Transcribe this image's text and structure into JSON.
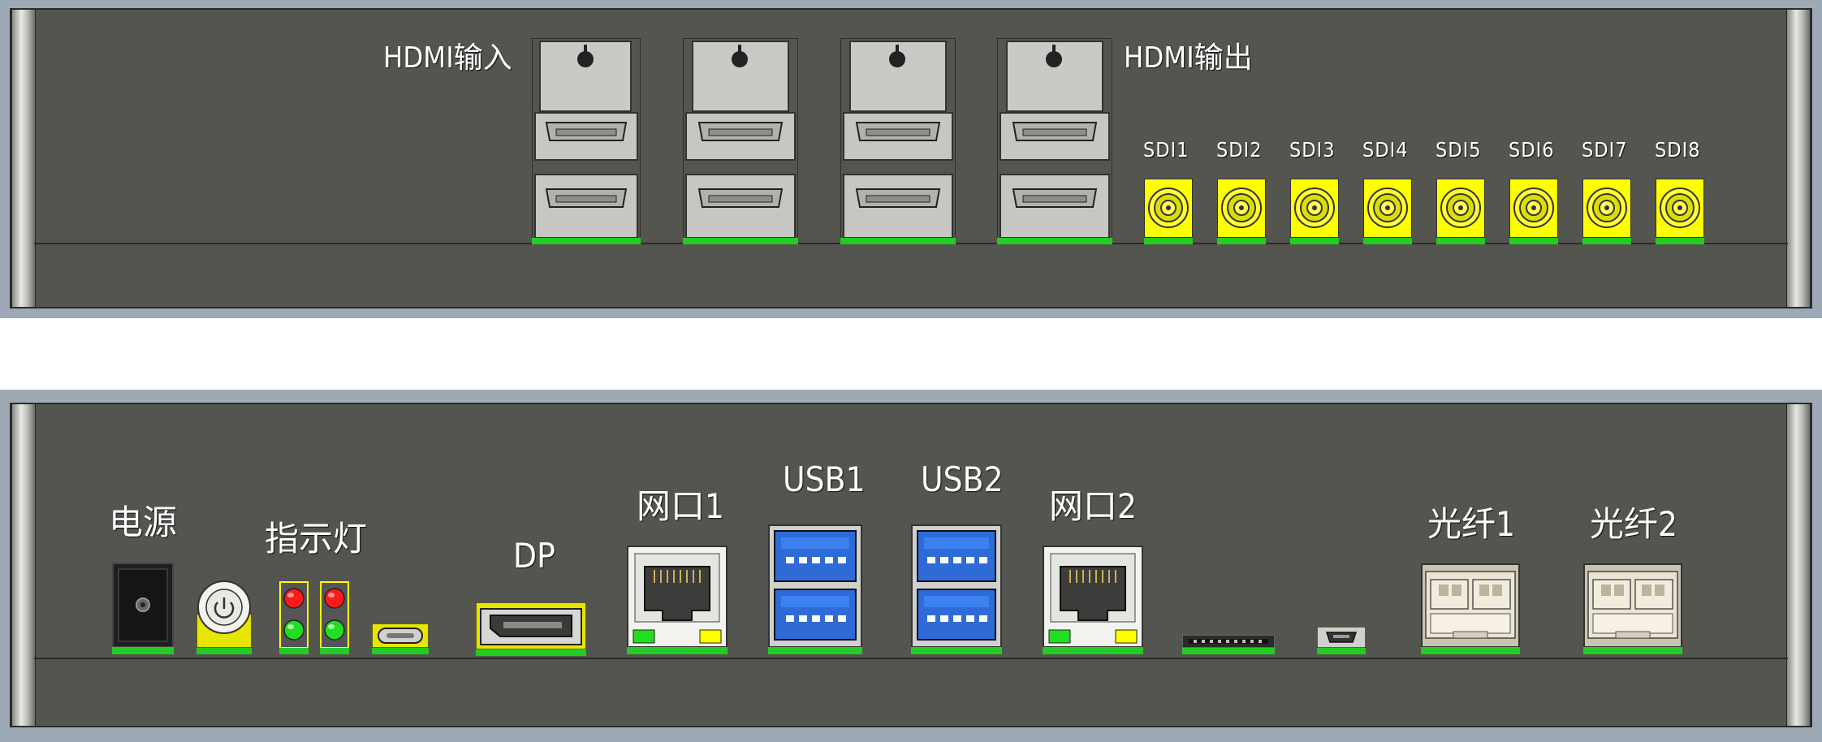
{
  "top_panel": {
    "labels": {
      "hdmi_in": "HDMI输入",
      "hdmi_out": "HDMI输出",
      "sdi": [
        "SDI1",
        "SDI2",
        "SDI3",
        "SDI4",
        "SDI5",
        "SDI6",
        "SDI7",
        "SDI8"
      ]
    },
    "hdmi_ports": [
      "hdmi-port-1",
      "hdmi-port-2",
      "hdmi-port-3",
      "hdmi-port-4"
    ],
    "sdi_color": "#ffff00"
  },
  "bottom_panel": {
    "labels": {
      "power": "电源",
      "indicator": "指示灯",
      "dp": "DP",
      "lan1": "网口1",
      "usb1": "USB1",
      "usb2": "USB2",
      "lan2": "网口2",
      "fiber1": "光纤1",
      "fiber2": "光纤2"
    },
    "led_colors": {
      "top": "#ff1a1a",
      "bottom": "#22dd22"
    },
    "usb_color": "#2f6bd6"
  },
  "colors": {
    "frame": "#9ea9b6",
    "panel_face": "#54554f",
    "pcb_green": "#22cc22",
    "connector_grey": "#c9c9c6"
  }
}
